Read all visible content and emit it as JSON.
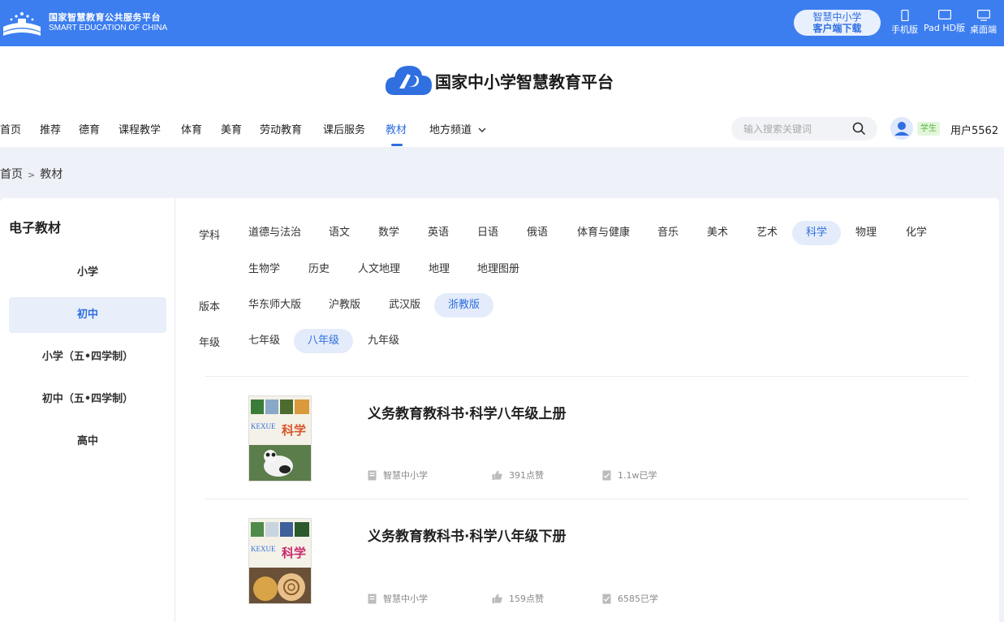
{
  "topbar": {
    "brand_cn": "国家智慧教育公共服务平台",
    "brand_en": "SMART EDUCATION OF CHINA",
    "download_line1": "智慧中小学",
    "download_line2": "客户端下载",
    "devices": [
      {
        "label": "手机版",
        "icon": "phone-icon"
      },
      {
        "label": "Pad HD版",
        "icon": "tablet-icon"
      },
      {
        "label": "桌面端",
        "icon": "desktop-icon"
      }
    ]
  },
  "header": {
    "site_title": "国家中小学智慧教育平台",
    "nav": [
      "首页",
      "推荐",
      "德育",
      "课程教学",
      "体育",
      "美育",
      "劳动教育",
      "课后服务",
      "教材",
      "地方频道"
    ],
    "active_nav": "教材",
    "search_placeholder": "输入搜索关键词",
    "role": "学生",
    "username": "用户5562"
  },
  "breadcrumb": {
    "home": "首页",
    "sep": ">",
    "current": "教材"
  },
  "sidebar": {
    "title": "电子教材",
    "items": [
      "小学",
      "初中",
      "小学（五•四学制）",
      "初中（五•四学制）",
      "高中"
    ],
    "active": "初中"
  },
  "filters": {
    "subject_label": "学科",
    "subjects": [
      "道德与法治",
      "语文",
      "数学",
      "英语",
      "日语",
      "俄语",
      "体育与健康",
      "音乐",
      "美术",
      "艺术",
      "科学",
      "物理",
      "化学",
      "生物学",
      "历史",
      "人文地理",
      "地理",
      "地理图册"
    ],
    "active_subject": "科学",
    "edition_label": "版本",
    "editions": [
      "华东师大版",
      "沪教版",
      "武汉版",
      "浙教版"
    ],
    "active_edition": "浙教版",
    "grade_label": "年级",
    "grades": [
      "七年级",
      "八年级",
      "九年级"
    ],
    "active_grade": "八年级"
  },
  "books": [
    {
      "title": "义务教育教科书·科学八年级上册",
      "publisher": "智慧中小学",
      "likes": "391点赞",
      "learned": "1.1w已学",
      "cover_word": "科学",
      "cover_pinyin": "KEXUE"
    },
    {
      "title": "义务教育教科书·科学八年级下册",
      "publisher": "智慧中小学",
      "likes": "159点赞",
      "learned": "6585已学",
      "cover_word": "科学",
      "cover_pinyin": "KEXUE"
    }
  ],
  "colors": {
    "brand_blue": "#3c7ef0",
    "accent": "#2f6fe0",
    "chip_bg": "#e4ecfb",
    "page_bg": "#eef1f8"
  }
}
